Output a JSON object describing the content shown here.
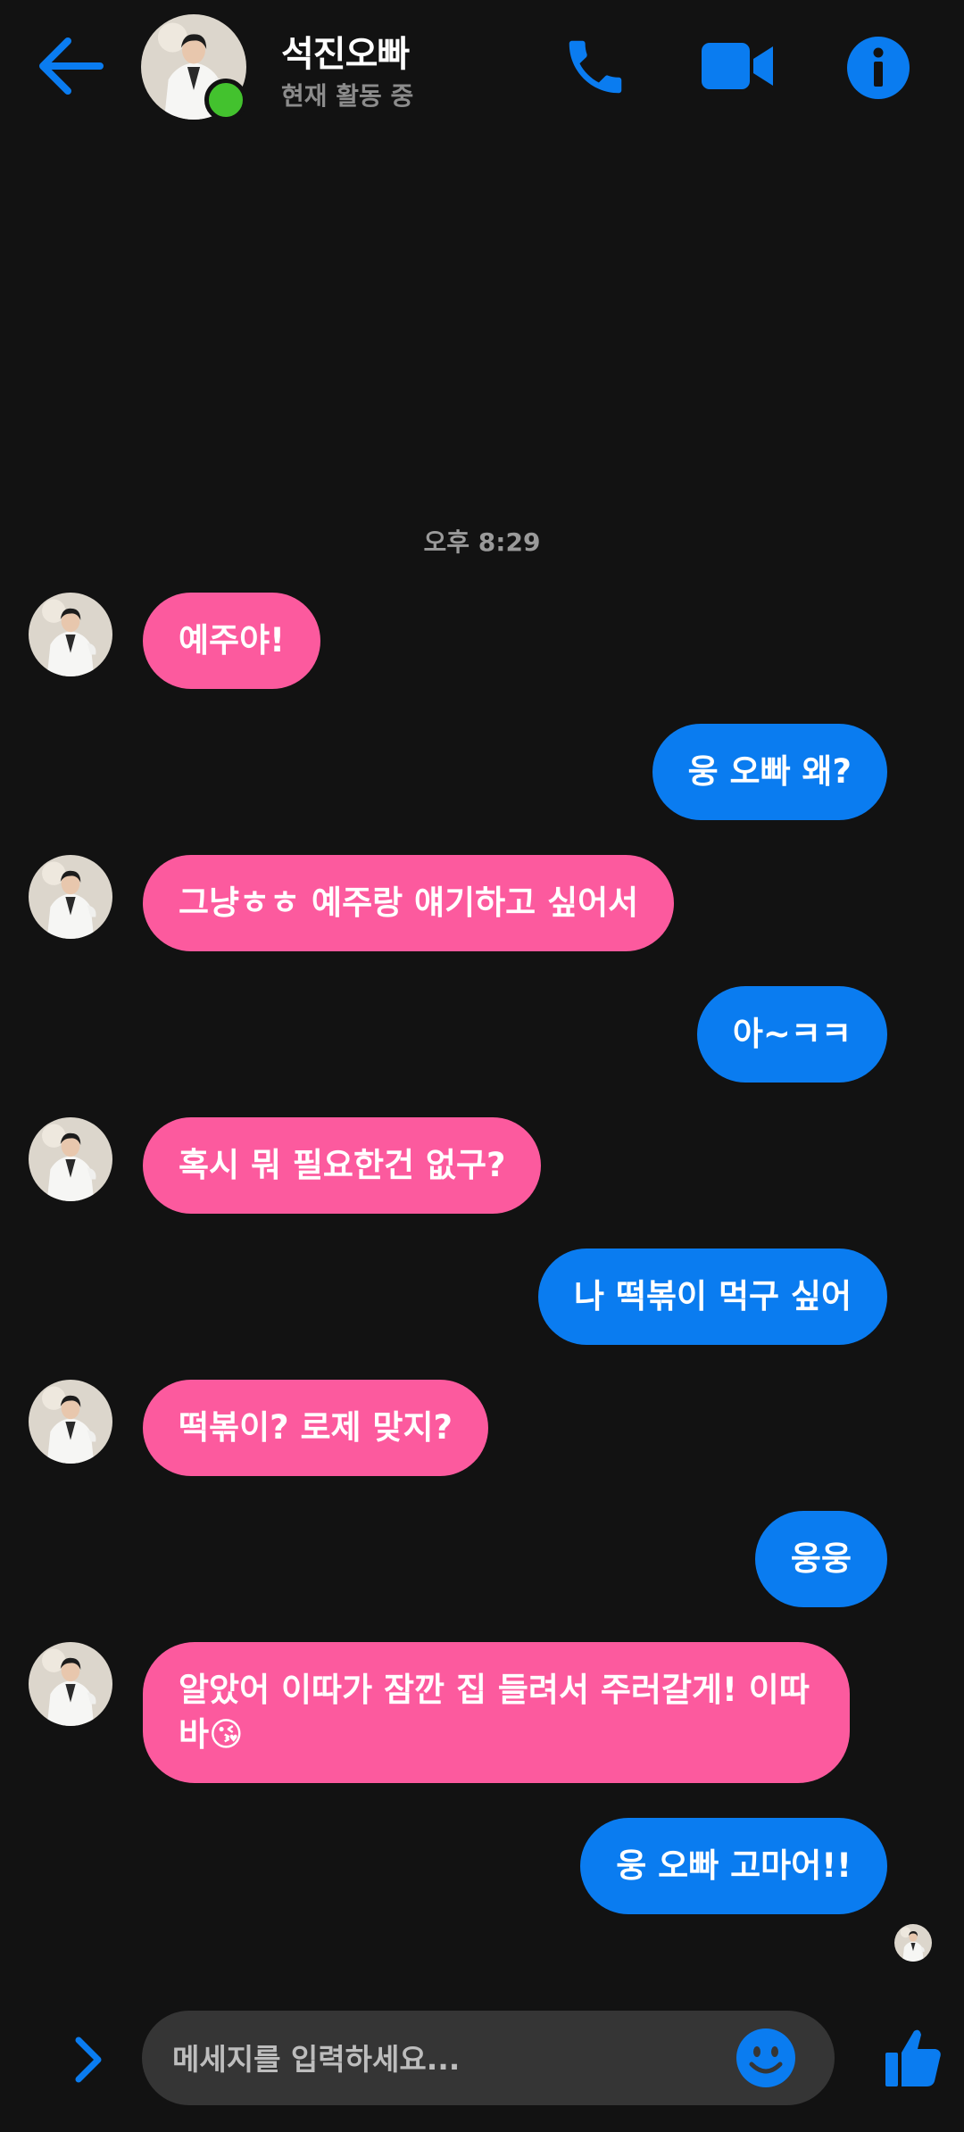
{
  "header": {
    "contact_name": "석진오빠",
    "status": "현재 활동 중",
    "icons": {
      "back": "arrow-left-icon",
      "call": "phone-icon",
      "video": "video-camera-icon",
      "info": "info-icon"
    }
  },
  "colors": {
    "background": "#121212",
    "accent": "#0a7cf0",
    "incoming_bubble": "#fc5a9e",
    "online": "#43c22e"
  },
  "conversation": {
    "timestamp": "오후 8:29",
    "messages": [
      {
        "from": "contact",
        "text": "예주야!"
      },
      {
        "from": "me",
        "text": "웅 오빠 왜?"
      },
      {
        "from": "contact",
        "text": "그냥ㅎㅎ 예주랑 얘기하고 싶어서"
      },
      {
        "from": "me",
        "text": "아~ㅋㅋ"
      },
      {
        "from": "contact",
        "text": "혹시 뭐 필요한건 없구?"
      },
      {
        "from": "me",
        "text": "나 떡볶이 먹구 싶어"
      },
      {
        "from": "contact",
        "text": "떡볶이? 로제 맞지?"
      },
      {
        "from": "me",
        "text": "웅웅"
      },
      {
        "from": "contact",
        "text": "알았어 이따가 잠깐 집 들려서 주러갈게! 이따바😘"
      },
      {
        "from": "me",
        "text": "웅 오빠 고마어!!"
      }
    ]
  },
  "composer": {
    "placeholder": "메세지를 입력하세요...",
    "icons": {
      "more": "chevron-right-icon",
      "emoji": "smiley-icon",
      "like": "thumbs-up-icon"
    }
  }
}
